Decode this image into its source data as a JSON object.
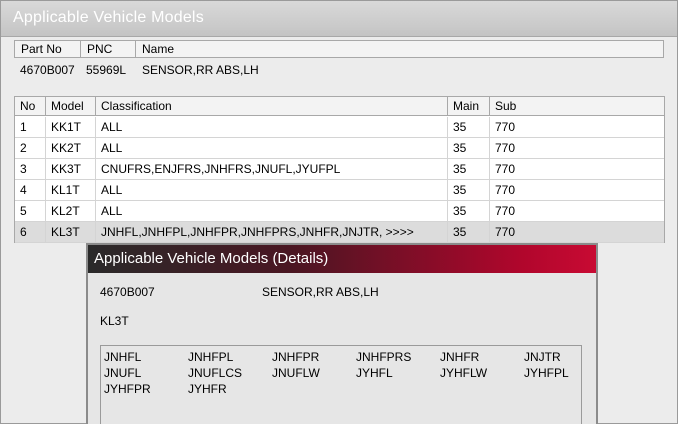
{
  "main_window": {
    "title": "Applicable Vehicle Models"
  },
  "part_info": {
    "headers": [
      "Part No",
      "PNC",
      "Name"
    ],
    "part_no": "4670B007",
    "pnc": "55969L",
    "name": "SENSOR,RR ABS,LH"
  },
  "models_table": {
    "columns": [
      "No",
      "Model",
      "Classification",
      "Main",
      "Sub"
    ],
    "rows": [
      {
        "no": "1",
        "model": "KK1T",
        "classification": "ALL",
        "main": "35",
        "sub": "770"
      },
      {
        "no": "2",
        "model": "KK2T",
        "classification": "ALL",
        "main": "35",
        "sub": "770"
      },
      {
        "no": "3",
        "model": "KK3T",
        "classification": "CNUFRS,ENJFRS,JNHFRS,JNUFL,JYUFPL",
        "main": "35",
        "sub": "770"
      },
      {
        "no": "4",
        "model": "KL1T",
        "classification": "ALL",
        "main": "35",
        "sub": "770"
      },
      {
        "no": "5",
        "model": "KL2T",
        "classification": "ALL",
        "main": "35",
        "sub": "770"
      },
      {
        "no": "6",
        "model": "KL3T",
        "classification": "JNHFL,JNHFPL,JNHFPR,JNHFPRS,JNHFR,JNJTR,  >>>>",
        "main": "35",
        "sub": "770",
        "selected": true
      }
    ]
  },
  "details_popup": {
    "title": "Applicable Vehicle Models (Details)",
    "part_no": "4670B007",
    "name": "SENSOR,RR ABS,LH",
    "model": "KL3T",
    "classification_codes": [
      "JNHFL",
      "JNHFPL",
      "JNHFPR",
      "JNHFPRS",
      "JNHFR",
      "JNJTR",
      "JNUFL",
      "JNUFLCS",
      "JNUFLW",
      "JYHFL",
      "JYHFLW",
      "JYHFPL",
      "JYHFPR",
      "JYHFR"
    ],
    "title_gradient_color": "#c80a33"
  }
}
